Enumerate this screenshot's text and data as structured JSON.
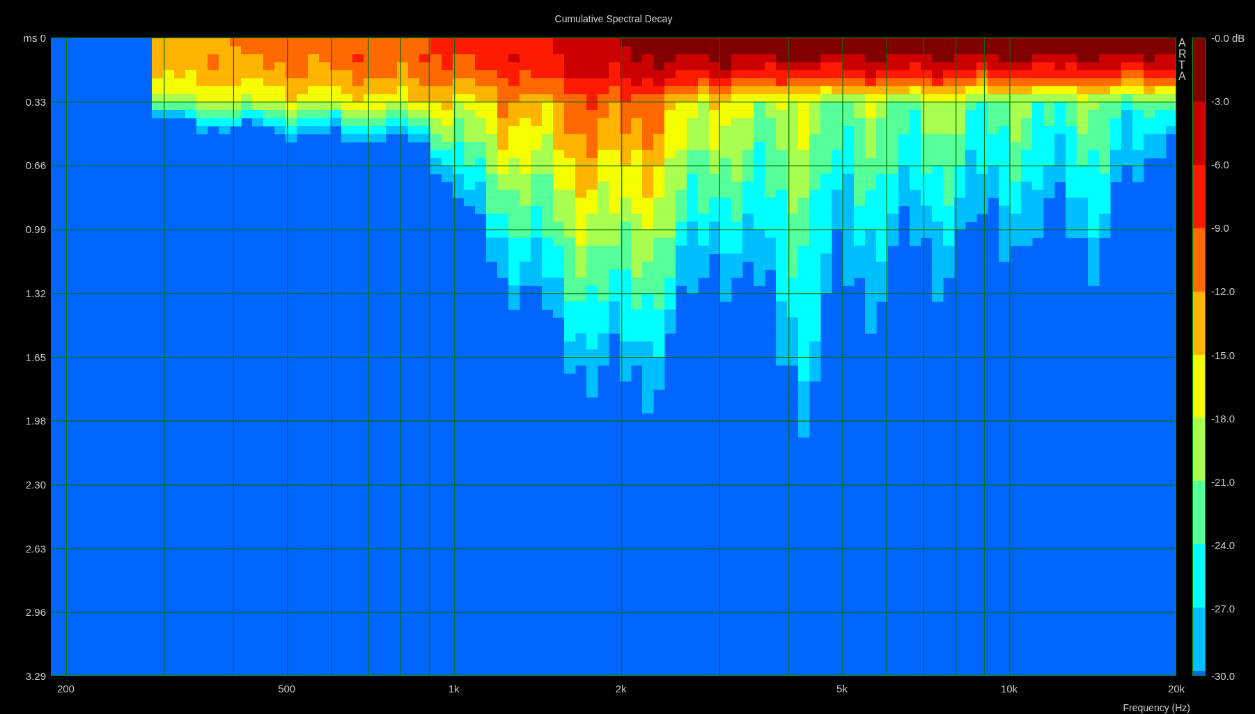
{
  "window": {
    "title": "Cumulative Spectral Decay"
  },
  "plot": {
    "y_axis": {
      "ticks": [
        "ms 0",
        "0.33",
        "0.66",
        "0.99",
        "1.32",
        "1.65",
        "1.98",
        "2.30",
        "2.63",
        "2.96",
        "3.29"
      ]
    },
    "x_axis": {
      "ticks": [
        "200",
        "500",
        "1k",
        "2k",
        "5k",
        "10k",
        "20k"
      ],
      "label": "Frequency (Hz)"
    },
    "brand": "ARTA"
  },
  "color_scale": {
    "ticks": [
      "-0.0 dB",
      "-3.0",
      "-6.0",
      "-9.0",
      "-12.0",
      "-15.0",
      "-18.0",
      "-21.0",
      "-24.0",
      "-27.0",
      "-30.0"
    ],
    "bands": [
      {
        "color": "#800000"
      },
      {
        "color": "#cc0000"
      },
      {
        "color": "#ff1a00"
      },
      {
        "color": "#ff6a00"
      },
      {
        "color": "#ffb400"
      },
      {
        "color": "#f5ff00"
      },
      {
        "color": "#a8ff50"
      },
      {
        "color": "#55ff99"
      },
      {
        "color": "#00ffff"
      },
      {
        "color": "#00bfff"
      },
      {
        "color": "#0066ff"
      }
    ]
  }
}
